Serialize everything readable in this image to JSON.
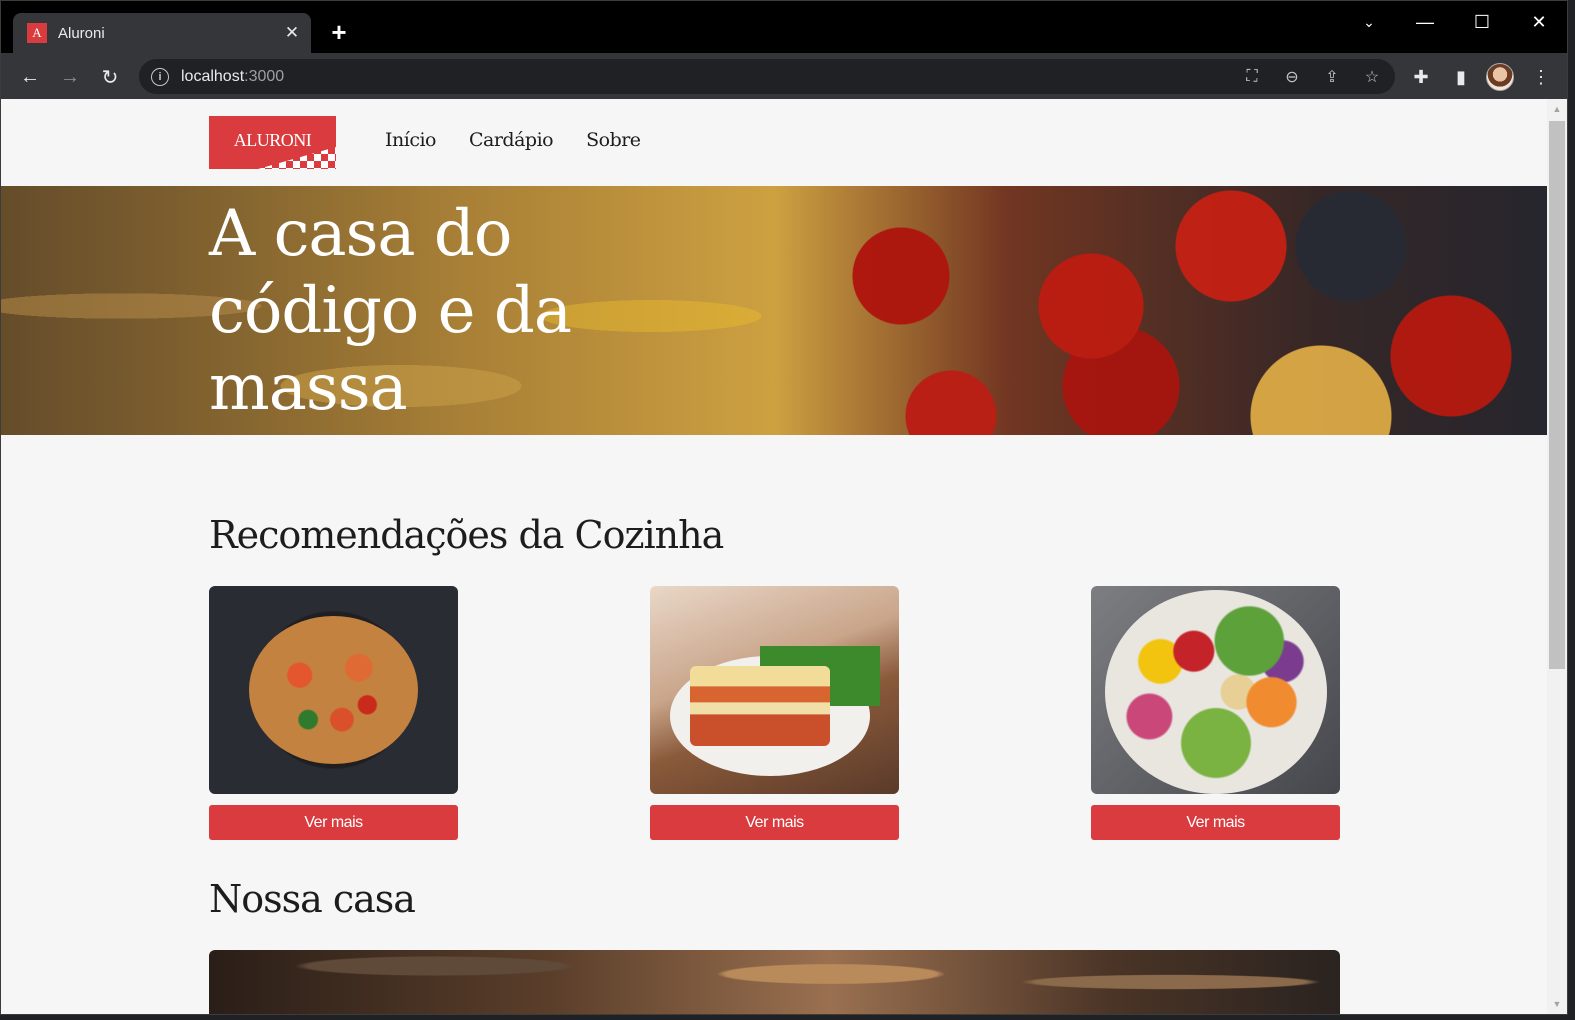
{
  "browser": {
    "tab_title": "Aluroni",
    "favicon_letter": "A",
    "url_host": "localhost",
    "url_port": ":3000",
    "icons": [
      "back-icon",
      "forward-icon",
      "reload-icon",
      "info-icon",
      "translate-icon",
      "zoom-out-icon",
      "share-icon",
      "star-icon",
      "extensions-icon",
      "side-panel-icon",
      "menu-icon"
    ]
  },
  "site": {
    "logo_text": "ALURONI",
    "nav": [
      "Início",
      "Cardápio",
      "Sobre"
    ],
    "hero_title": "A casa do código e da massa",
    "recommendations_title": "Recomendações da Cozinha",
    "cards": [
      {
        "image": "pasta-with-shrimp",
        "button": "Ver mais"
      },
      {
        "image": "lasagna",
        "button": "Ver mais"
      },
      {
        "image": "salad-bowl",
        "button": "Ver mais"
      }
    ],
    "house_title": "Nossa casa"
  },
  "colors": {
    "accent": "#d93b3e",
    "background": "#f6f6f6",
    "text": "#1d1d1d"
  }
}
